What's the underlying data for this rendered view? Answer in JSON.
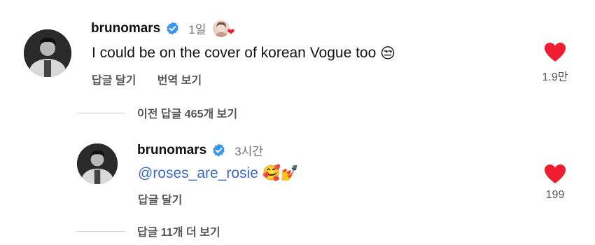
{
  "comment1": {
    "username": "brunomars",
    "time": "1일",
    "text": "I could be on the cover of korean Vogue too",
    "text_emoji": "😒",
    "reply_label": "답글 달기",
    "translate_label": "번역 보기",
    "like_count": "1.9만"
  },
  "view_previous": {
    "label": "이전 답글 465개 보기"
  },
  "comment2": {
    "username": "brunomars",
    "time": "3시간",
    "mention": "@roses_are_rosie",
    "emojis": "🥰💅",
    "reply_label": "답글 달기",
    "like_count": "199"
  },
  "view_more": {
    "label": "답글 11개 더 보기"
  },
  "colors": {
    "heart": "#ee1d2f",
    "verified": "#3897f0",
    "mention": "#3b6bbf"
  }
}
